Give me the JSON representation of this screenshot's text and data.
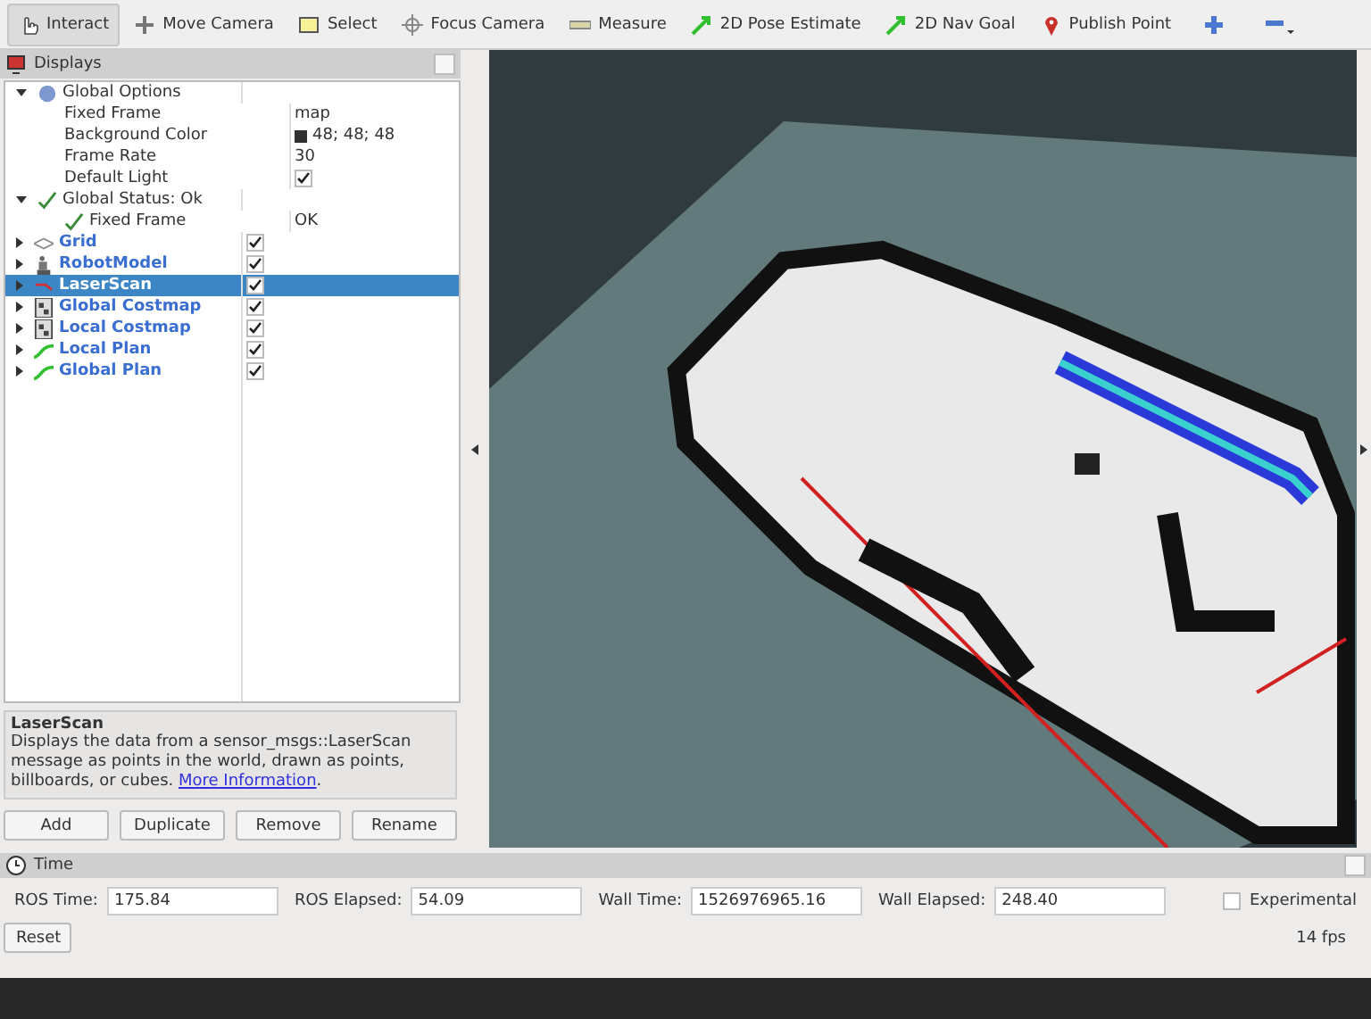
{
  "toolbar": {
    "tools": [
      {
        "label": "Interact",
        "kind": "hand",
        "selected": true
      },
      {
        "label": "Move Camera",
        "kind": "move",
        "selected": false
      },
      {
        "label": "Select",
        "kind": "select",
        "selected": false
      },
      {
        "label": "Focus Camera",
        "kind": "focus",
        "selected": false
      },
      {
        "label": "Measure",
        "kind": "ruler",
        "selected": false
      },
      {
        "label": "2D Pose Estimate",
        "kind": "arrow",
        "selected": false
      },
      {
        "label": "2D Nav Goal",
        "kind": "arrow",
        "selected": false
      },
      {
        "label": "Publish Point",
        "kind": "pin",
        "selected": false
      }
    ]
  },
  "displays": {
    "title": "Displays",
    "tree": [
      {
        "label": "Global Options",
        "kind": "options",
        "expanded": true,
        "children": [
          {
            "label": "Fixed Frame",
            "kind": "text",
            "value": "map"
          },
          {
            "label": "Background Color",
            "kind": "color",
            "color": "#303030",
            "value": "48; 48; 48"
          },
          {
            "label": "Frame Rate",
            "kind": "text",
            "value": "30"
          },
          {
            "label": "Default Light",
            "kind": "check",
            "checked": true
          }
        ]
      },
      {
        "label": "Global Status: Ok",
        "kind": "status",
        "expanded": true,
        "children": [
          {
            "label": "Fixed Frame",
            "kind": "status",
            "value": "OK"
          }
        ]
      },
      {
        "label": "Grid",
        "kind": "grid",
        "expanded": false,
        "checked": true,
        "selected": false
      },
      {
        "label": "RobotModel",
        "kind": "robot",
        "expanded": false,
        "checked": true,
        "selected": false
      },
      {
        "label": "LaserScan",
        "kind": "laser",
        "expanded": false,
        "checked": true,
        "selected": true
      },
      {
        "label": "Global Costmap",
        "kind": "costmap",
        "expanded": false,
        "checked": true,
        "selected": false
      },
      {
        "label": "Local Costmap",
        "kind": "costmap",
        "expanded": false,
        "checked": true,
        "selected": false
      },
      {
        "label": "Local Plan",
        "kind": "path",
        "expanded": false,
        "checked": true,
        "selected": false
      },
      {
        "label": "Global Plan",
        "kind": "path",
        "expanded": false,
        "checked": true,
        "selected": false
      }
    ],
    "description": {
      "title": "LaserScan",
      "text": "Displays the data from a sensor_msgs::LaserScan message as points in the world, drawn as points, billboards, or cubes.",
      "link": "More Information",
      "after": "."
    },
    "buttons": [
      "Add",
      "Duplicate",
      "Remove",
      "Rename"
    ]
  },
  "time": {
    "title": "Time",
    "fields": [
      {
        "label": "ROS Time:",
        "value": "175.84"
      },
      {
        "label": "ROS Elapsed:",
        "value": "54.09"
      },
      {
        "label": "Wall Time:",
        "value": "1526976965.16"
      },
      {
        "label": "Wall Elapsed:",
        "value": "248.40"
      }
    ],
    "experimental": {
      "label": "Experimental",
      "checked": false
    },
    "reset": "Reset",
    "fps": "14 fps"
  }
}
